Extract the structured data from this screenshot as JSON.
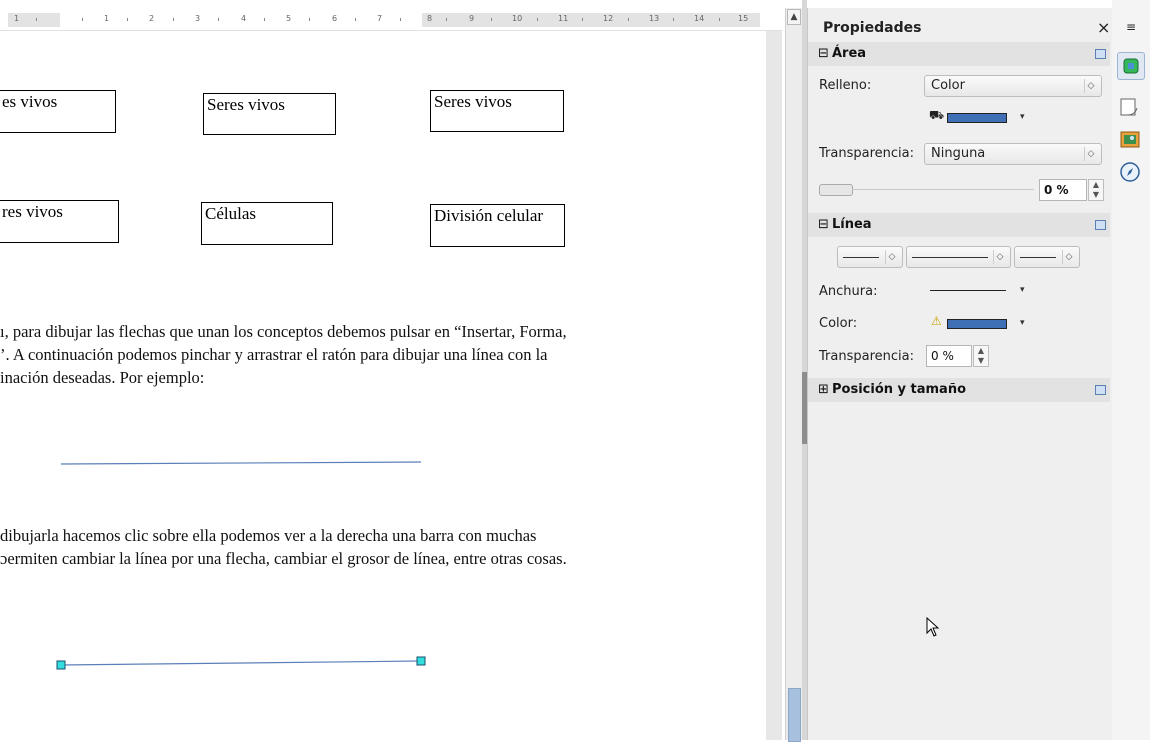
{
  "ruler": {
    "numbers": [
      "1",
      "1",
      "2",
      "3",
      "4",
      "5",
      "6",
      "7",
      "8",
      "9",
      "10",
      "11",
      "12",
      "13",
      "14",
      "15"
    ]
  },
  "document": {
    "boxes": [
      "es vivos",
      "Seres vivos",
      "Seres vivos",
      "res vivos",
      "Células",
      "División celular"
    ],
    "paragraph1": [
      "ı, para dibujar las flechas que unan los conceptos debemos pulsar en “Insertar, Forma,",
      "’. A continuación podemos pinchar y arrastrar el ratón para dibujar una línea con la",
      "inación deseadas. Por ejemplo:"
    ],
    "paragraph2": [
      "dibujarla hacemos clic sobre ella podemos ver a la derecha una barra con muchas",
      "ɔermiten cambiar la línea por una flecha, cambiar el grosor de línea, entre otras cosas."
    ]
  },
  "sidebar": {
    "title": "Propiedades",
    "close_glyph": "×",
    "menu_glyph": "≡",
    "area": {
      "title": "Área",
      "expand_glyph": "⊟",
      "fill_label": "Relleno:",
      "fill_value": "Color",
      "fill_color": "#3f6fb5",
      "transparency_label": "Transparencia:",
      "transparency_value": "Ninguna",
      "percent_value": "0 %"
    },
    "line": {
      "title": "Línea",
      "expand_glyph": "⊟",
      "width_label": "Anchura:",
      "color_label": "Color:",
      "line_color": "#3f6fb5",
      "transparency_label": "Transparencia:",
      "transparency_value": "0 %"
    },
    "position": {
      "title": "Posición y tamaño",
      "expand_glyph": "⊞"
    }
  },
  "tabs": [
    "properties-icon",
    "styles-icon",
    "gallery-icon",
    "navigator-icon"
  ],
  "colors": {
    "accent": "#3f6fb5",
    "handle": "#33dddd",
    "line": "#5b7fb8"
  }
}
